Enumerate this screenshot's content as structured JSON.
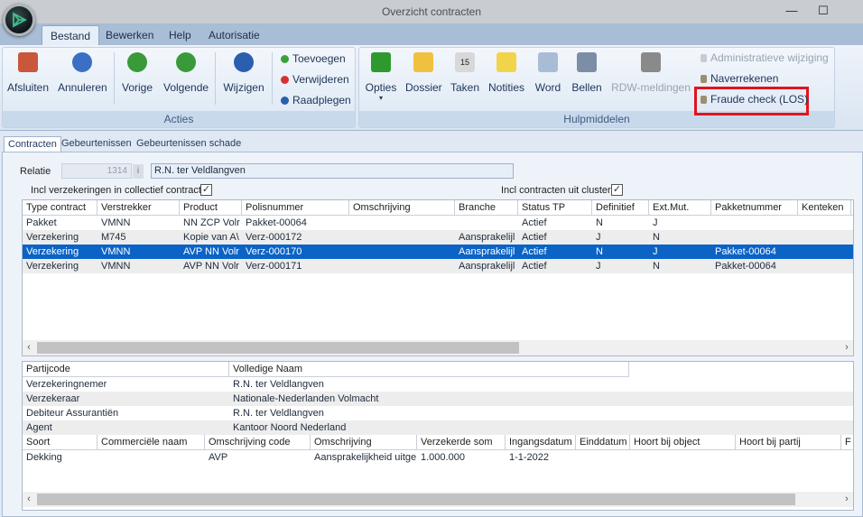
{
  "window": {
    "title": "Overzicht contracten",
    "minimize": "—",
    "maximize": "☐"
  },
  "ribbon_tabs": [
    {
      "label": "Bestand",
      "active": true
    },
    {
      "label": "Bewerken"
    },
    {
      "label": "Help"
    },
    {
      "label": "Autorisatie"
    }
  ],
  "acties": {
    "label": "Acties",
    "buttons": [
      {
        "label": "Afsluiten",
        "icon": "house-icon"
      },
      {
        "label": "Annuleren",
        "icon": "stop-icon"
      },
      {
        "label": "Vorige",
        "icon": "arrow-left-icon"
      },
      {
        "label": "Volgende",
        "icon": "arrow-right-icon"
      },
      {
        "label": "Wijzigen",
        "icon": "play-icon"
      }
    ],
    "small": [
      {
        "label": "Toevoegen",
        "color": "#3aa03a"
      },
      {
        "label": "Verwijderen",
        "color": "#d83030"
      },
      {
        "label": "Raadplegen",
        "color": "#2a5fb0"
      }
    ]
  },
  "hulpmiddelen": {
    "label": "Hulpmiddelen",
    "buttons": [
      {
        "label": "Opties",
        "icon": "options-cube-icon"
      },
      {
        "label": "Dossier",
        "icon": "folder-icon"
      },
      {
        "label": "Taken",
        "icon": "calendar-icon",
        "badge": "15"
      },
      {
        "label": "Notities",
        "icon": "note-icon"
      },
      {
        "label": "Word",
        "icon": "word-document-icon"
      },
      {
        "label": "Bellen",
        "icon": "phone-icon"
      },
      {
        "label": "RDW-meldingen",
        "icon": "car-icon",
        "disabled": true
      }
    ],
    "small": [
      {
        "label": "Administratieve wijziging",
        "disabled": true
      },
      {
        "label": "Naverrekenen"
      },
      {
        "label": "Fraude check (LOS)",
        "highlighted": true
      }
    ]
  },
  "page_tabs": [
    {
      "label": "Contracten",
      "active": true
    },
    {
      "label": "Gebeurtenissen"
    },
    {
      "label": "Gebeurtenissen schade"
    }
  ],
  "relatie": {
    "label": "Relatie",
    "number": "1314",
    "name": "R.N. ter Veldlangven"
  },
  "options": {
    "collectief_label": "Incl verzekeringen in collectief contract",
    "collectief_checked": true,
    "cluster_label": "Incl contracten uit cluster",
    "cluster_checked": true
  },
  "contracts": {
    "columns": [
      "Type contract",
      "Verstrekker",
      "Product",
      "Polisnummer",
      "Omschrijving",
      "Branche",
      "Status TP",
      "Definitief",
      "Ext.Mut.",
      "Pakketnummer",
      "Kenteken"
    ],
    "rows": [
      [
        "Pakket",
        "VMNN",
        "NN ZCP Volr",
        "Pakket-00064",
        "",
        "",
        "Actief",
        "N",
        "J",
        "",
        ""
      ],
      [
        "Verzekering",
        "M745",
        "Kopie van A\\",
        "Verz-000172",
        "",
        "Aansprakelijl",
        "Actief",
        "J",
        "N",
        "",
        ""
      ],
      [
        "Verzekering",
        "VMNN",
        "AVP NN Volr",
        "Verz-000170",
        "",
        "Aansprakelijl",
        "Actief",
        "N",
        "J",
        "Pakket-00064",
        ""
      ],
      [
        "Verzekering",
        "VMNN",
        "AVP NN Volr",
        "Verz-000171",
        "",
        "Aansprakelijl",
        "Actief",
        "J",
        "N",
        "Pakket-00064",
        ""
      ]
    ],
    "selected_row": 2
  },
  "parties": {
    "columns": [
      "Partijcode",
      "Volledige Naam"
    ],
    "rows": [
      [
        "Verzekeringnemer",
        "R.N. ter Veldlangven"
      ],
      [
        "Verzekeraar",
        "Nationale-Nederlanden Volmacht"
      ],
      [
        "Debiteur Assurantiën",
        "R.N. ter Veldlangven"
      ],
      [
        "Agent",
        "Kantoor Noord Nederland"
      ]
    ]
  },
  "coverage": {
    "columns": [
      "Soort",
      "Commerciële naam",
      "Omschrijving code",
      "Omschrijving",
      "Verzekerde som",
      "Ingangsdatum",
      "Einddatum",
      "Hoort bij object",
      "Hoort bij partij",
      "F"
    ],
    "rows": [
      [
        "Dekking",
        "",
        "AVP",
        "Aansprakelijkheid uitge",
        "1.000.000",
        "1-1-2022",
        "",
        "",
        "",
        ""
      ]
    ]
  }
}
